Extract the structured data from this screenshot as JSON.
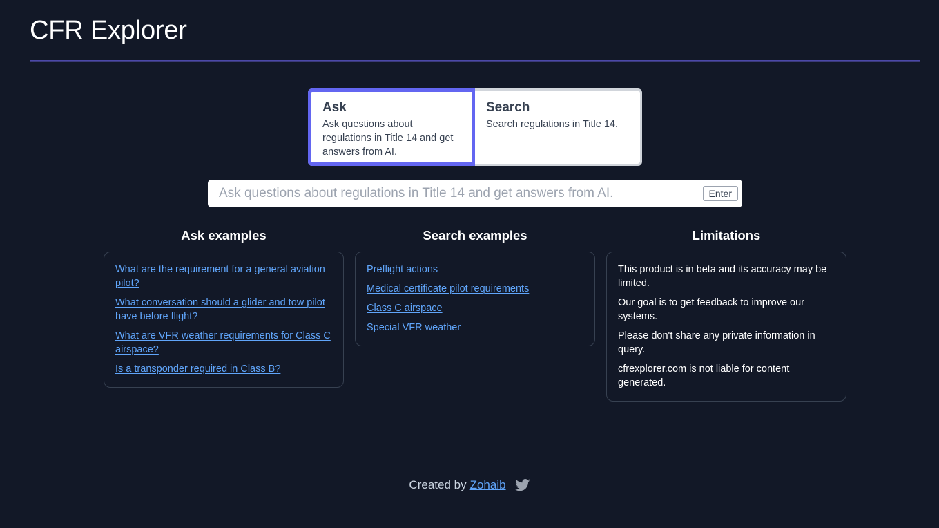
{
  "header": {
    "title": "CFR Explorer"
  },
  "modes": [
    {
      "id": "ask",
      "title": "Ask",
      "description": "Ask questions about regulations in Title 14 and get answers from AI.",
      "selected": true
    },
    {
      "id": "search",
      "title": "Search",
      "description": "Search regulations in Title 14.",
      "selected": false
    }
  ],
  "query": {
    "value": "",
    "placeholder": "Ask questions about regulations in Title 14 and get answers from AI.",
    "enter_label": "Enter"
  },
  "ask_examples": {
    "title": "Ask examples",
    "items": [
      "What are the requirement for a general aviation pilot?",
      "What conversation should a glider and tow pilot have before flight?",
      "What are VFR weather requirements for Class C airspace?",
      "Is a transponder required in Class B?"
    ]
  },
  "search_examples": {
    "title": "Search examples",
    "items": [
      "Preflight actions",
      "Medical certificate pilot requirements",
      "Class C airspace",
      "Special VFR weather"
    ]
  },
  "limitations": {
    "title": "Limitations",
    "items": [
      "This product is in beta and its accuracy may be limited.",
      "Our goal is to get feedback to improve our systems.",
      "Please don't share any private information in query.",
      "cfrexplorer.com is not liable for content generated."
    ]
  },
  "footer": {
    "created_by": "Created by",
    "author": "Zohaib",
    "social_icon": "twitter-icon"
  },
  "colors": {
    "background": "#121827",
    "accent": "#6366f1",
    "link": "#60a5fa"
  }
}
